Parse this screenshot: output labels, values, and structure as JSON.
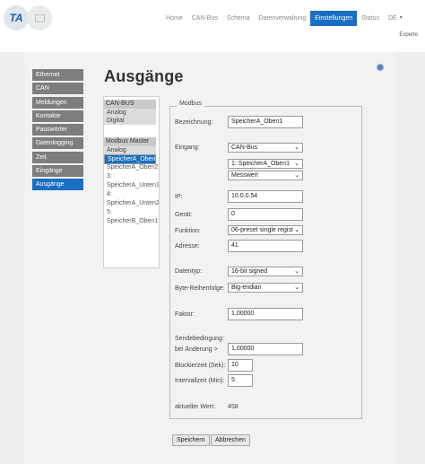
{
  "header": {
    "nav": [
      {
        "label": "Home",
        "active": false
      },
      {
        "label": "CAN-Bus",
        "active": false
      },
      {
        "label": "Schema",
        "active": false
      },
      {
        "label": "Datenverwaltung",
        "active": false
      },
      {
        "label": "Einstellungen",
        "active": true
      },
      {
        "label": "Status",
        "active": false
      }
    ],
    "language": "DE",
    "mode": "Experte"
  },
  "sidebar": {
    "items": [
      {
        "label": "Ethernet",
        "active": false
      },
      {
        "label": "CAN",
        "active": false
      },
      {
        "label": "Meldungen",
        "active": false
      },
      {
        "label": "Kontakte",
        "active": false
      },
      {
        "label": "Passwörter",
        "active": false
      },
      {
        "label": "Datenlogging",
        "active": false
      },
      {
        "label": "Zeit",
        "active": false
      },
      {
        "label": "Eingänge",
        "active": false
      },
      {
        "label": "Ausgänge",
        "active": true
      }
    ]
  },
  "page": {
    "title": "Ausgänge"
  },
  "tree": {
    "canbus": {
      "label": "CAN-BUS",
      "items": [
        "Analog",
        "Digital"
      ]
    },
    "modbus": {
      "label": "Modbus Master",
      "sub": "Analog",
      "entries": [
        {
          "num": "1:",
          "name": "SpeicherA_Oben1",
          "selected": true
        },
        {
          "num": "2:",
          "name": "SpeicherA_Oben2",
          "selected": false
        },
        {
          "num": "3:",
          "name": "SpeicherA_Unten1",
          "selected": false
        },
        {
          "num": "4:",
          "name": "SpeicherA_Unten2",
          "selected": false
        },
        {
          "num": "5:",
          "name": "SpeicherB_Oben1",
          "selected": false
        }
      ]
    }
  },
  "form": {
    "legend": "Modbus",
    "bezeichnung": {
      "label": "Bezeichnung:",
      "value": "SpeicherA_Oben1"
    },
    "eingang": {
      "label": "Eingang:",
      "source": "CAN-Bus",
      "channel": "1: SpeicherA_Oben1",
      "type": "Messwert"
    },
    "ip": {
      "label": "IP:",
      "value": "10.0.0.54"
    },
    "geraet": {
      "label": "Gerät:",
      "value": "0"
    },
    "funktion": {
      "label": "Funktion:",
      "value": "06-preset single register"
    },
    "adresse": {
      "label": "Adresse:",
      "value": "41"
    },
    "datentyp": {
      "label": "Datentyp:",
      "value": "16-bit signed"
    },
    "reihenfolge": {
      "label": "Byte-Reihenfolge:",
      "value": "Big-endian"
    },
    "faktor": {
      "label": "Faktor:",
      "value": "1,00000"
    },
    "sendebedingung": {
      "label": "Sendebedingung:",
      "bei_label": "bei Änderung >",
      "value": "1,00000"
    },
    "blockierzeit": {
      "label": "Blockierzeit (Sek):",
      "value": "10"
    },
    "intervallzeit": {
      "label": "Intervallzeit (Min):",
      "value": "5"
    },
    "aktueller": {
      "label": "aktueller Wert:",
      "value": "458"
    }
  },
  "buttons": {
    "save": "Speichern",
    "cancel": "Abbrechen"
  },
  "colors": {
    "accent": "#1a6fc2",
    "sidebar": "#7d7d7d"
  }
}
